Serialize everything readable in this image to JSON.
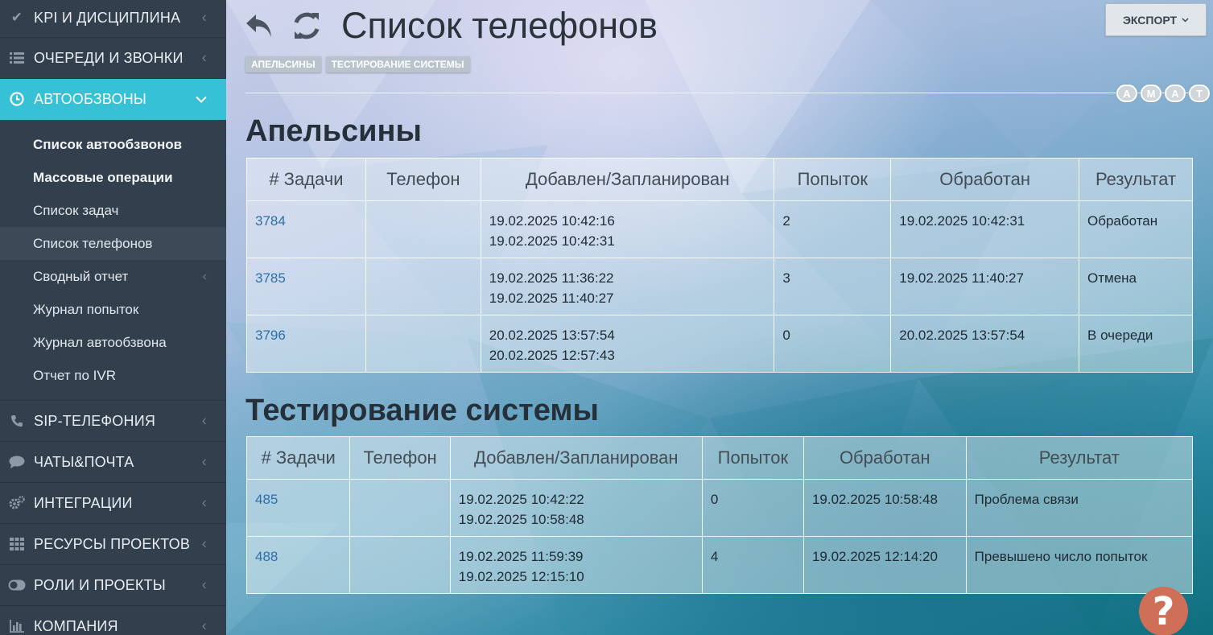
{
  "sidebar": {
    "items": [
      {
        "label": "KPI И ДИСЦИПЛИНА",
        "icon": "check-icon"
      },
      {
        "label": "ОЧЕРЕДИ И ЗВОНКИ",
        "icon": "list-icon"
      },
      {
        "label": "АВТООБЗВОНЫ",
        "icon": "clock-icon"
      },
      {
        "label": "SIP-ТЕЛЕФОНИЯ",
        "icon": "phone-icon"
      },
      {
        "label": "ЧАТЫ&ПОЧТА",
        "icon": "chat-icon"
      },
      {
        "label": "ИНТЕГРАЦИИ",
        "icon": "gears-icon"
      },
      {
        "label": "РЕСУРСЫ ПРОЕКТОВ",
        "icon": "grid-icon"
      },
      {
        "label": "РОЛИ И ПРОЕКТЫ",
        "icon": "toggle-icon"
      },
      {
        "label": "КОМПАНИЯ",
        "icon": "bar-chart-icon"
      }
    ],
    "subitems": [
      {
        "label": "Список автообзвонов"
      },
      {
        "label": "Массовые операции"
      },
      {
        "label": "Список задач"
      },
      {
        "label": "Список телефонов"
      },
      {
        "label": "Сводный отчет"
      },
      {
        "label": "Журнал попыток"
      },
      {
        "label": "Журнал автообзвона"
      },
      {
        "label": "Отчет по IVR"
      }
    ]
  },
  "header": {
    "title": "Список телефонов",
    "crumbs": [
      "АПЕЛЬСИНЫ",
      "ТЕСТИРОВАНИЕ СИСТЕМЫ"
    ],
    "export_label": "ЭКСПОРТ",
    "avatars": [
      "A",
      "M",
      "A",
      "T"
    ]
  },
  "tables": [
    {
      "title": "Апельсины",
      "columns": [
        "# Задачи",
        "Телефон",
        "Добавлен/Запланирован",
        "Попыток",
        "Обработан",
        "Результат"
      ],
      "rows": [
        {
          "id": "3784",
          "phone": "",
          "added": "19.02.2025 10:42:16",
          "planned": "19.02.2025 10:42:31",
          "attempts": "2",
          "processed": "19.02.2025 10:42:31",
          "result": "Обработан"
        },
        {
          "id": "3785",
          "phone": "",
          "added": "19.02.2025 11:36:22",
          "planned": "19.02.2025 11:40:27",
          "attempts": "3",
          "processed": "19.02.2025 11:40:27",
          "result": "Отмена"
        },
        {
          "id": "3796",
          "phone": "",
          "added": "20.02.2025 13:57:54",
          "planned": "20.02.2025 12:57:43",
          "attempts": "0",
          "processed": "20.02.2025 13:57:54",
          "result": "В очереди"
        }
      ]
    },
    {
      "title": "Тестирование системы",
      "columns": [
        "# Задачи",
        "Телефон",
        "Добавлен/Запланирован",
        "Попыток",
        "Обработан",
        "Результат"
      ],
      "rows": [
        {
          "id": "485",
          "phone": "",
          "added": "19.02.2025 10:42:22",
          "planned": "19.02.2025 10:58:48",
          "attempts": "0",
          "processed": "19.02.2025 10:58:48",
          "result": "Проблема связи"
        },
        {
          "id": "488",
          "phone": "",
          "added": "19.02.2025 11:59:39",
          "planned": "19.02.2025 12:15:10",
          "attempts": "4",
          "processed": "19.02.2025 12:14:20",
          "result": "Превышено число попыток"
        }
      ]
    }
  ],
  "help": {
    "label": "?"
  },
  "colors": {
    "accent": "#36c1d6",
    "sidebar": "#323f4d",
    "link": "#2e6fa8",
    "help": "#cf6f58"
  }
}
